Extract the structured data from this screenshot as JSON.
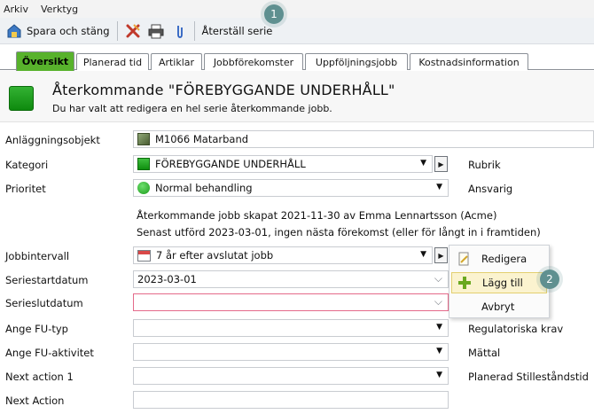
{
  "menu": {
    "items": [
      "Arkiv",
      "Verktyg"
    ]
  },
  "toolbar": {
    "save_close_label": "Spara och stäng",
    "reset_series_label": "Återställ serie",
    "icons": [
      "save-close-icon",
      "cancel-icon",
      "print-icon",
      "attach-icon"
    ]
  },
  "callouts": {
    "one": "1",
    "two": "2"
  },
  "tabs": [
    "Översikt",
    "Planerad tid",
    "Artiklar",
    "Jobbförekomster",
    "Uppföljningsjobb",
    "Kostnadsinformation"
  ],
  "header": {
    "title": "Återkommande \"FÖREBYGGANDE UNDERHÅLL\"",
    "subtitle": "Du har valt att redigera en hel serie återkommande jobb."
  },
  "form": {
    "object_label": "Anläggningsobjekt",
    "object_value": "M1066  Matarband",
    "category_label": "Kategori",
    "category_value": "FÖREBYGGANDE UNDERHÅLL",
    "priority_label": "Prioritet",
    "priority_value": "Normal behandling",
    "created_info": "Återkommande jobb skapat 2021-11-30 av Emma Lennartsson (Acme)",
    "executed_info": "Senast utförd 2023-03-01, ingen nästa förekomst (eller för långt in i framtiden)",
    "interval_label": "Jobbintervall",
    "interval_value": "7 år efter avslutat jobb",
    "start_label": "Seriestartdatum",
    "start_value": "2023-03-01",
    "end_label": "Serieslutdatum",
    "end_value": "",
    "fu_type_label": "Ange FU-typ",
    "fu_activity_label": "Ange FU-aktivitet",
    "next_action1_label": "Next action 1",
    "next_action_label": "Next Action"
  },
  "right_labels": {
    "rubrik": "Rubrik",
    "ansvarig": "Ansvarig",
    "regulatory": "Regulatoriska krav",
    "mattal": "Mättal",
    "planned_downtime": "Planerad Stilleståndstid"
  },
  "context_menu": {
    "items": [
      {
        "label": "Redigera",
        "icon": "edit-icon"
      },
      {
        "label": "Lägg till",
        "icon": "add-icon",
        "highlighted": true
      },
      {
        "label": "Avbryt",
        "icon": ""
      }
    ]
  },
  "colors": {
    "active_tab": "#58b22c",
    "callout": "#5f9090",
    "highlight": "#fbf3cf"
  }
}
